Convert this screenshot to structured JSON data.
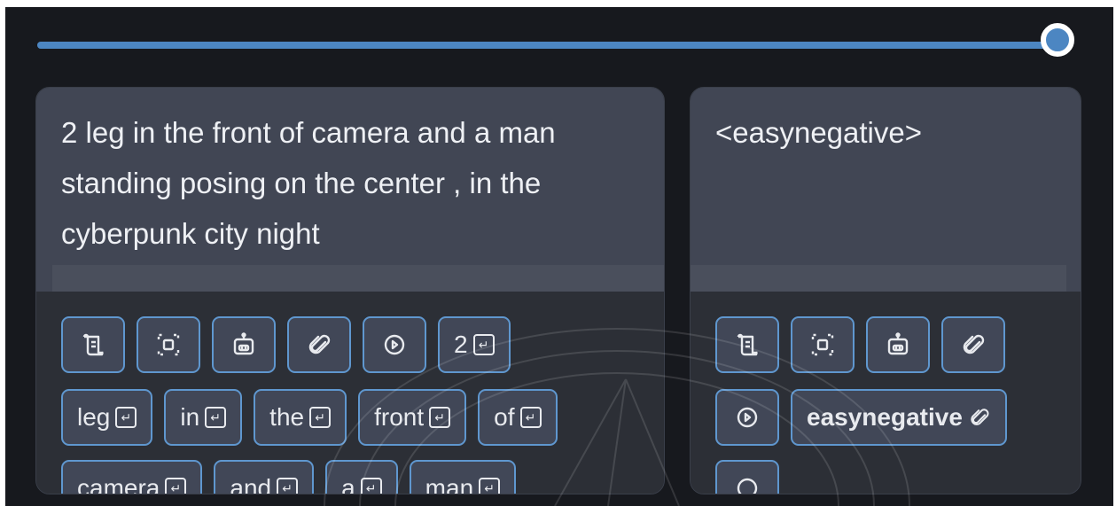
{
  "slider": {
    "value_fraction": 1.0,
    "accent": "#4c86c2"
  },
  "positive": {
    "prompt": "2 leg in the front of camera and a man\nstanding posing on the center , in the\ncyberpunk city night",
    "tool_icons": [
      "scroll-icon",
      "select-frame-icon",
      "robot-icon",
      "paperclip-icon",
      "play-circle-icon"
    ],
    "tokens_row1": [
      "2"
    ],
    "tokens_row2": [
      "leg",
      "in",
      "the",
      "front",
      "of"
    ],
    "tokens_row3": [
      "camera",
      "and",
      "a",
      "man"
    ]
  },
  "negative": {
    "prompt": "<easynegative>",
    "tool_icons": [
      "scroll-icon",
      "select-frame-icon",
      "robot-icon",
      "paperclip-icon",
      "play-circle-icon"
    ],
    "embedding_chip": "easynegative"
  },
  "colors": {
    "background": "#17191e",
    "chip_border": "#5f97cf",
    "chip_bg": "#414757"
  }
}
